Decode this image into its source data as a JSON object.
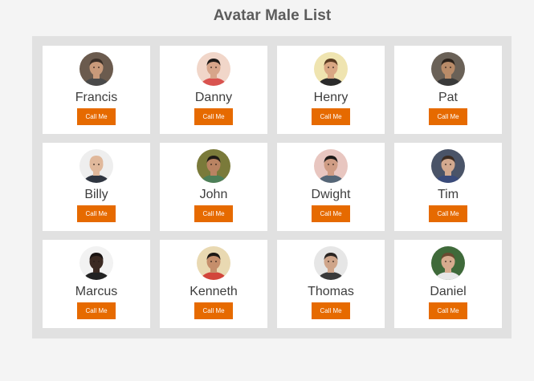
{
  "page": {
    "title": "Avatar Male List"
  },
  "colors": {
    "page_background": "#f4f4f4",
    "panel_background": "#e1e1e1",
    "card_background": "#ffffff",
    "button_background": "#e66a00",
    "button_text": "#ffffff",
    "title_text": "#5c5c5c",
    "name_text": "#3d3d3d"
  },
  "people": [
    {
      "name": "Francis",
      "button_label": "Call Me",
      "avatar_icon": "person-photo-icon",
      "bg": "#6b5b4e",
      "skin": "#c99a7a",
      "hair": "#3b2f27",
      "shirt": "#4a4a4a"
    },
    {
      "name": "Danny",
      "button_label": "Call Me",
      "avatar_icon": "person-photo-icon",
      "bg": "#f1d6c9",
      "skin": "#d7a58a",
      "hair": "#1e1a18",
      "shirt": "#d9534f"
    },
    {
      "name": "Henry",
      "button_label": "Call Me",
      "avatar_icon": "person-photo-icon",
      "bg": "#efe4b0",
      "skin": "#d9a783",
      "hair": "#5a3c22",
      "shirt": "#2b2b2b"
    },
    {
      "name": "Pat",
      "button_label": "Call Me",
      "avatar_icon": "person-photo-icon",
      "bg": "#6a6157",
      "skin": "#b98b68",
      "hair": "#2b211a",
      "shirt": "#3a3a3a"
    },
    {
      "name": "Billy",
      "button_label": "Call Me",
      "avatar_icon": "person-photo-icon",
      "bg": "#eeeeee",
      "skin": "#e0b89b",
      "hair": "#e0b89b",
      "shirt": "#2f3540"
    },
    {
      "name": "John",
      "button_label": "Call Me",
      "avatar_icon": "person-photo-icon",
      "bg": "#7a7a3a",
      "skin": "#b98362",
      "hair": "#1f1a16",
      "shirt": "#4d7f58"
    },
    {
      "name": "Dwight",
      "button_label": "Call Me",
      "avatar_icon": "person-photo-icon",
      "bg": "#e8c6c0",
      "skin": "#cf9c84",
      "hair": "#1f1b19",
      "shirt": "#556677"
    },
    {
      "name": "Tim",
      "button_label": "Call Me",
      "avatar_icon": "person-photo-icon",
      "bg": "#4a5468",
      "skin": "#d2a98f",
      "hair": "#3c2c22",
      "shirt": "#3a4b7a"
    },
    {
      "name": "Marcus",
      "button_label": "Call Me",
      "avatar_icon": "person-photo-icon",
      "bg": "#f2f2f2",
      "skin": "#3b2a22",
      "hair": "#1a1412",
      "shirt": "#222222"
    },
    {
      "name": "Kenneth",
      "button_label": "Call Me",
      "avatar_icon": "person-photo-icon",
      "bg": "#e9d9b2",
      "skin": "#c58e6b",
      "hair": "#1e1915",
      "shirt": "#d2453b"
    },
    {
      "name": "Thomas",
      "button_label": "Call Me",
      "avatar_icon": "person-photo-icon",
      "bg": "#e6e6e6",
      "skin": "#cfa58a",
      "hair": "#2a2522",
      "shirt": "#3a3a3a"
    },
    {
      "name": "Daniel",
      "button_label": "Call Me",
      "avatar_icon": "person-photo-icon",
      "bg": "#3f6a3a",
      "skin": "#d6ab8e",
      "hair": "#6a4a30",
      "shirt": "#e7e7e7"
    }
  ]
}
